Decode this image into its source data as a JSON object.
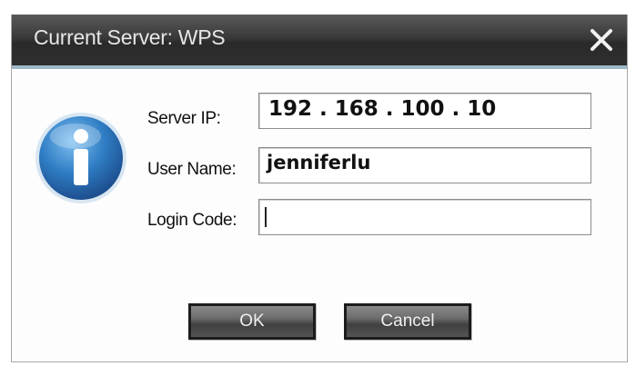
{
  "dialog": {
    "title": "Current Server: WPS",
    "close_icon": "close-icon"
  },
  "icon": "info-icon",
  "fields": {
    "server_ip_label": "Server IP:",
    "server_ip_value": "192 . 168 . 100 . 10",
    "user_name_label": "User Name:",
    "user_name_value": "jenniferlu",
    "login_code_label": "Login Code:",
    "login_code_value": ""
  },
  "buttons": {
    "ok_label": "OK",
    "cancel_label": "Cancel"
  },
  "colors": {
    "title_bar": "#2e2e2e",
    "accent": "#9fb8c7",
    "icon_blue": "#2f7dc4"
  }
}
